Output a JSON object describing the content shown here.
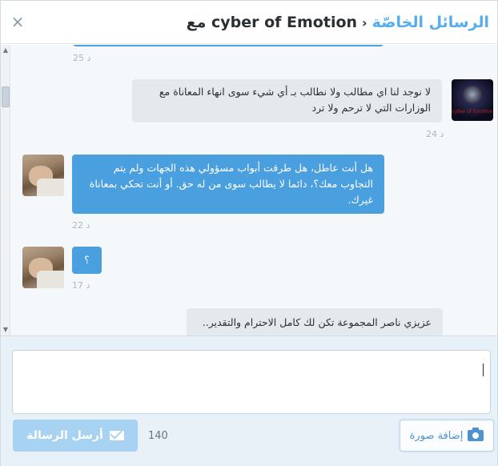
{
  "header": {
    "close_icon": "×",
    "crumb_link": "الرسائل الخاصّة",
    "separator": "›",
    "conversation_with": "مع cyber of Emotion"
  },
  "messages": [
    {
      "id": "m0",
      "direction": "sent",
      "text": "",
      "timestamp": "25 د"
    },
    {
      "id": "m1",
      "direction": "received",
      "text": "لا نوجد لنا اي مطالب ولا نطالب بـ أي شيء سوى انهاء المعاناة مع الوزارات التي لا ترحم ولا ترد",
      "timestamp": "24 د",
      "avatar": "cyber-of-emotion-avatar",
      "avatar_label": "cyber of Emotion"
    },
    {
      "id": "m2",
      "direction": "sent",
      "text": "هل أنت عاطل، هل طرقت أبواب مسؤولي هذه الجهات ولم يتم التجاوب معك؟، دائما لا يطالب سوى من له حق. أو أنت تحكي بمعاناة غيرك.",
      "timestamp": "22 د",
      "avatar": "user-photo-avatar"
    },
    {
      "id": "m3",
      "direction": "sent",
      "text": "؟",
      "timestamp": "17 د",
      "avatar": "user-photo-avatar"
    },
    {
      "id": "m4",
      "direction": "received",
      "text": "عزيزي ناصر المجموعة تكن لك كامل الاحترام والتقدير..",
      "timestamp": ""
    }
  ],
  "scrollbar": {
    "up": "▲",
    "down": "▼"
  },
  "compose": {
    "input_value": "",
    "send_label": "أرسل الرسالة",
    "char_counter": "140",
    "photo_label": "إضافة صورة"
  },
  "colors": {
    "accent": "#55acee",
    "sent_bubble": "#4a9fdf",
    "received_bubble": "#e4e9ed",
    "send_button_disabled": "#a8d2f2"
  }
}
